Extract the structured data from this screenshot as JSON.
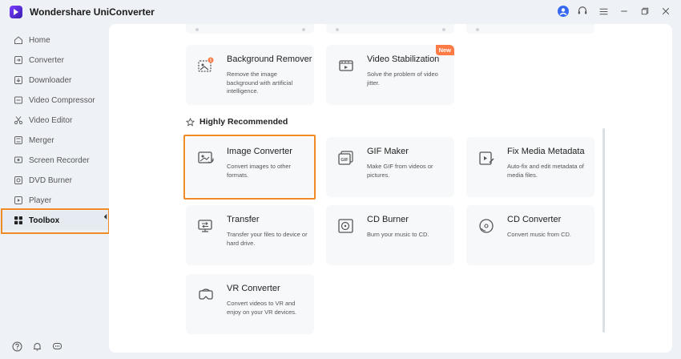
{
  "app": {
    "title": "Wondershare UniConverter",
    "accent_color": "#f08a24",
    "new_badge_color": "#ff7a45"
  },
  "window_controls": {
    "icons": [
      "account-icon",
      "support-headset-icon",
      "menu-icon",
      "minimize-icon",
      "restore-icon",
      "close-icon"
    ]
  },
  "sidebar": {
    "items": [
      {
        "label": "Home",
        "icon": "home-icon"
      },
      {
        "label": "Converter",
        "icon": "converter-icon"
      },
      {
        "label": "Downloader",
        "icon": "downloader-icon"
      },
      {
        "label": "Video Compressor",
        "icon": "video-compressor-icon"
      },
      {
        "label": "Video Editor",
        "icon": "scissors-icon"
      },
      {
        "label": "Merger",
        "icon": "merger-icon"
      },
      {
        "label": "Screen Recorder",
        "icon": "screen-recorder-icon"
      },
      {
        "label": "DVD Burner",
        "icon": "dvd-burner-icon"
      },
      {
        "label": "Player",
        "icon": "player-icon"
      },
      {
        "label": "Toolbox",
        "icon": "toolbox-grid-icon",
        "active": true
      }
    ],
    "bottom_icons": [
      "help-icon",
      "notification-bell-icon",
      "feedback-icon"
    ]
  },
  "tools_top": [
    {
      "title": "Background Remover",
      "desc": "Remove the image background with artificial intelligence.",
      "icon": "background-remover-icon",
      "badge_count": "5"
    },
    {
      "title": "Video Stabilization",
      "desc": "Solve the problem of video jitter.",
      "icon": "video-stabilization-icon",
      "badge": "New"
    }
  ],
  "recommended": {
    "heading": "Highly Recommended",
    "tools": [
      {
        "title": "Image Converter",
        "desc": "Convert images to other formats.",
        "icon": "image-converter-icon",
        "highlighted": true
      },
      {
        "title": "GIF Maker",
        "desc": "Make GIF from videos or pictures.",
        "icon": "gif-maker-icon"
      },
      {
        "title": "Fix Media Metadata",
        "desc": "Auto-fix and edit metadata of media files.",
        "icon": "fix-metadata-icon"
      },
      {
        "title": "Transfer",
        "desc": "Transfer your files to device or hard drive.",
        "icon": "transfer-icon"
      },
      {
        "title": "CD Burner",
        "desc": "Burn your music to CD.",
        "icon": "cd-burner-icon"
      },
      {
        "title": "CD Converter",
        "desc": "Convert music from CD.",
        "icon": "cd-converter-icon"
      },
      {
        "title": "VR Converter",
        "desc": "Convert videos to VR and enjoy on your VR devices.",
        "icon": "vr-converter-icon"
      }
    ]
  }
}
